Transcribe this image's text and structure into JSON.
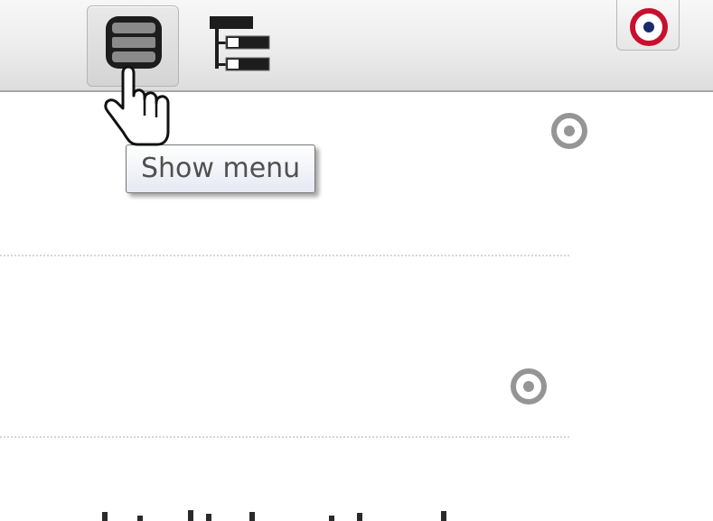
{
  "toolbar": {
    "buttons": [
      {
        "name": "menu-button",
        "icon": "stacked-list-icon",
        "state": "pressed"
      },
      {
        "name": "tree-view-button",
        "icon": "tree-hierarchy-icon"
      },
      {
        "name": "target-button",
        "icon": "target-icon"
      }
    ]
  },
  "tooltip": {
    "text": "Show menu"
  },
  "rows": [
    {
      "name": "row-1",
      "selector_icon": "radio-icon"
    },
    {
      "name": "row-2",
      "selector_icon": "radio-icon"
    }
  ],
  "colors": {
    "toolbar_top": "#f7f7f7",
    "toolbar_bottom": "#dddddd",
    "divider": "#d6d6d6",
    "radio": "#959595",
    "target_ring": "#c8102e",
    "target_center": "#1a2a6c"
  },
  "cursor": {
    "icon": "hand-pointer-icon"
  }
}
